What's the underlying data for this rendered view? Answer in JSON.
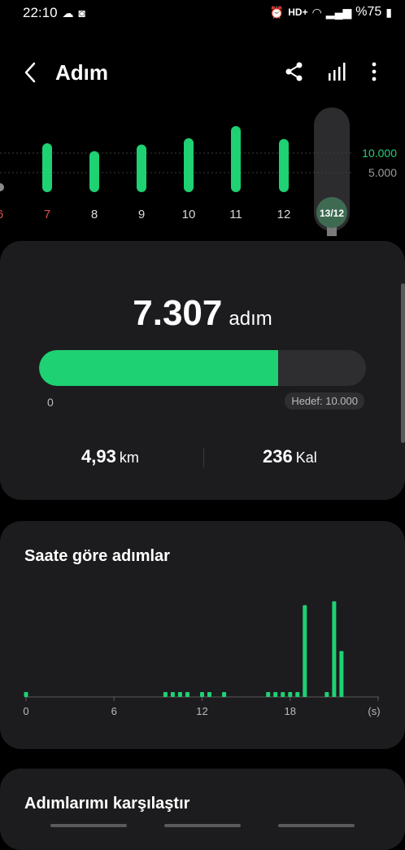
{
  "status_bar": {
    "time": "22:10",
    "left_icons": [
      "cloud-icon",
      "screenshot-icon"
    ],
    "right_icons": [
      "alarm-icon",
      "wifi-icon",
      "signal-icon"
    ],
    "network": "HD+",
    "battery": "%75"
  },
  "header": {
    "title": "Adım",
    "icons": [
      "back-icon",
      "share-icon",
      "bar-chart-icon",
      "more-icon"
    ]
  },
  "week_chart": {
    "days": [
      "6",
      "7",
      "8",
      "9",
      "10",
      "11",
      "12",
      "13/12"
    ],
    "values": [
      200,
      12500,
      10500,
      12200,
      13800,
      16900,
      13600,
      7307
    ],
    "selected_label": "13/12",
    "ref_lines": [
      {
        "label": "10.000",
        "value": 10000,
        "color": "#1ed173"
      },
      {
        "label": "5.000",
        "value": 5000,
        "color": "#9a9a9a"
      }
    ]
  },
  "steps": {
    "value": "7.307",
    "unit": "adım",
    "progress_fraction": 0.7307,
    "min_label": "0",
    "goal_label": "Hedef: 10.000",
    "distance_value": "4,93",
    "distance_unit": "km",
    "calories_value": "236",
    "calories_unit": "Kal"
  },
  "hourly": {
    "title": "Saate göre adımlar",
    "x_ticks": [
      "0",
      "6",
      "12",
      "18"
    ],
    "x_unit": "(s)",
    "hours": [
      0,
      9.5,
      10,
      10.5,
      11,
      12,
      12.5,
      13.5,
      16.5,
      17,
      17.5,
      18,
      18.5,
      19,
      20.5,
      21,
      21.5
    ],
    "values": [
      10,
      10,
      10,
      10,
      10,
      10,
      10,
      10,
      10,
      10,
      10,
      10,
      10,
      1200,
      10,
      1250,
      600
    ]
  },
  "compare": {
    "title": "Adımlarımı karşılaştır"
  },
  "colors": {
    "accent": "#1ed173",
    "card": "#1c1c1e",
    "weekend": "#e05050"
  }
}
